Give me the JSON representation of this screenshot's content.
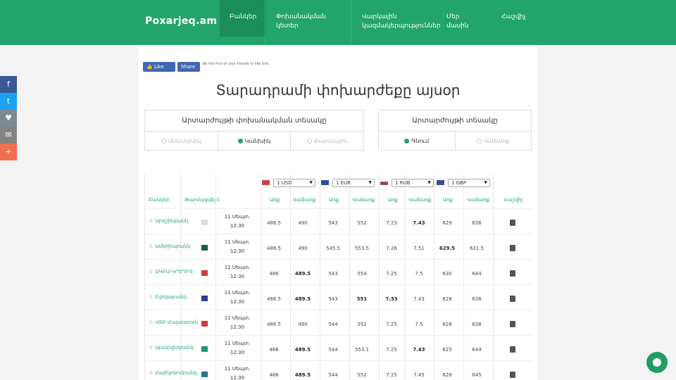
{
  "header": {
    "logo": "Poxarjeq.am",
    "nav": [
      {
        "label": "Բանկեր"
      },
      {
        "label": "Փոխանակման կետեր"
      },
      {
        "label": "Վարկային կազմակերպություններ"
      },
      {
        "label": "Մեր մասին"
      },
      {
        "label": "Հաշվիչ"
      }
    ],
    "colors": {
      "brand": "#22a46c",
      "brand_dark": "#1b8c5b"
    }
  },
  "share": [
    {
      "icon": "facebook-icon",
      "glyph": "f",
      "color": "#3b5998"
    },
    {
      "icon": "twitter-icon",
      "glyph": "t",
      "color": "#1da1f2"
    },
    {
      "icon": "chat-icon",
      "glyph": "♥",
      "color": "#7d8a94"
    },
    {
      "icon": "email-icon",
      "glyph": "✉",
      "color": "#848484"
    },
    {
      "icon": "share-plus-icon",
      "glyph": "+",
      "color": "#f06f50"
    }
  ],
  "social": {
    "like_label": "Like",
    "share_label": "Share",
    "text": "Be the first of your friends to like this."
  },
  "page_title": "Տարադրամի փոխարժեքը այսօր",
  "filters": {
    "exchange_type": {
      "title": "Արտարժույթի փոխանակման տեսակը",
      "options": [
        "Անկանխիկ",
        "Կանխիկ",
        "Քարտային"
      ],
      "selected": 1
    },
    "rate_type": {
      "title": "Արտարժույթի տեսակը",
      "options": [
        "Գնում",
        "Վաճառք"
      ],
      "selected": 0
    }
  },
  "table": {
    "currencies": [
      "1 USD",
      "1 EUR",
      "1 RUB",
      "1 GBP"
    ],
    "headers": {
      "bank": "Բանկեր",
      "updated": "Թարմացվել է",
      "buy": "Առք",
      "sell": "Վաճառք",
      "calc": "Հաշվիչ"
    },
    "rows": [
      {
        "bank": "Արդշինբանկ",
        "date": "11 Սեպտ.",
        "time": "12:30",
        "vals": [
          "486.5",
          "490",
          "543",
          "552",
          "7.23",
          "7.43",
          "629",
          "638"
        ]
      },
      {
        "bank": "Ամերիաբանկ",
        "date": "11 Սեպտ.",
        "time": "12:30",
        "vals": [
          "486.5",
          "490",
          "545.5",
          "553.5",
          "7.26",
          "7.51",
          "629.5",
          "631.5"
        ]
      },
      {
        "bank": "ԱԿԲԱ-ԿՐԵԴԻՏ",
        "date": "11 Սեպտ.",
        "time": "12:30",
        "vals": [
          "486",
          "489.5",
          "543",
          "554",
          "7.25",
          "7.5",
          "630",
          "644"
        ]
      },
      {
        "bank": "Էվոկաբանկ",
        "date": "11 Սեպտ.",
        "time": "12:30",
        "vals": [
          "486.5",
          "489.5",
          "543",
          "551",
          "7.33",
          "7.43",
          "628",
          "638"
        ]
      },
      {
        "bank": "ՎՏԲ-Հայաստան",
        "date": "11 Սեպտ.",
        "time": "12:30",
        "vals": [
          "486.5",
          "490",
          "544",
          "552",
          "7.25",
          "7.5",
          "628",
          "638"
        ]
      },
      {
        "bank": "Արաբկիրբանկ",
        "date": "11 Սեպտ.",
        "time": "12:30",
        "vals": [
          "486",
          "489.5",
          "544",
          "553.1",
          "7.25",
          "7.43",
          "625",
          "644"
        ]
      },
      {
        "bank": "Հայէկոնոմբանկ",
        "date": "11 Սեպտ.",
        "time": "12:30",
        "vals": [
          "486",
          "489.5",
          "544",
          "552",
          "7.25",
          "7.45",
          "628",
          "645"
        ]
      }
    ]
  }
}
